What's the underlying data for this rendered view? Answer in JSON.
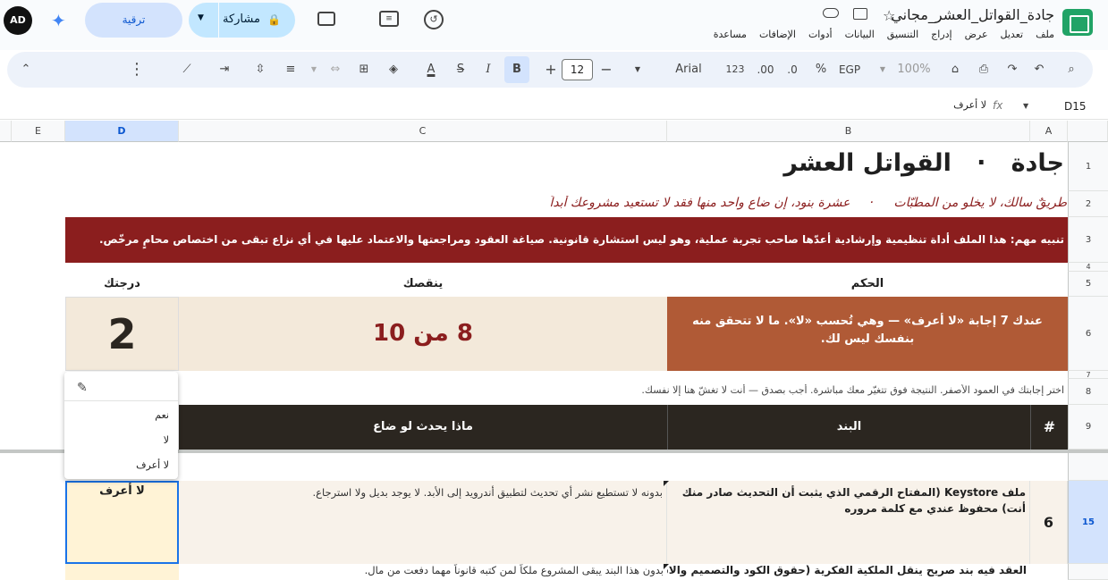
{
  "app": {
    "doc_title": "جادة_القواتل_العشر_مجاني",
    "menu": [
      "ملف",
      "تعديل",
      "عرض",
      "إدراج",
      "التنسيق",
      "البيانات",
      "أدوات",
      "الإضافات",
      "مساعدة"
    ],
    "share_label": "مشاركة",
    "upgrade_label": "ترقية",
    "avatar_initials": "AD"
  },
  "toolbar": {
    "zoom": "100%",
    "currency": "EGP",
    "percent": "%",
    "dec_decrease": ".0",
    "dec_increase": ".00",
    "number_format": "123",
    "font": "Arial",
    "font_size": "12",
    "bold": "B",
    "italic": "I",
    "text_color": "A"
  },
  "formula_bar": {
    "cell_ref": "D15",
    "fx": "fx",
    "value": "لا أعرف"
  },
  "columns": [
    "A",
    "B",
    "C",
    "D",
    "E"
  ],
  "rows": [
    "1",
    "2",
    "3",
    "4",
    "5",
    "6",
    "7",
    "8",
    "9",
    "15"
  ],
  "sheet": {
    "title": "جادة   ·   القواتل العشر",
    "subtitle": "طريقٌ سالك، لا يخلو من المطبّات     ·     عشرة بنود، إن ضاع واحد منها فقد لا تستعيد مشروعك أبداً",
    "warning": "تنبيه مهم:  هذا الملف أداة تنظيمية وإرشادية أعدّها صاحب تجربة عملية،  وهو ليس استشارة قانونية. صياغة العقود ومراجعتها والاعتماد عليها في أي نزاع تبقى من اختصاص محامٍ مرخّص.",
    "header_verdict": "الحكم",
    "header_missing": "ينقصك",
    "header_score": "درجتك",
    "verdict_text": "عندك 7 إجابة «لا أعرف» — وهي تُحسب «لا». ما لا تتحقق منه بنفسك ليس لك.",
    "missing_value": "8 من 10",
    "score_value": "2",
    "instruction": "اختر إجابتك في العمود الأصفر. النتيجة فوق تتغيّر معك مباشرة. أجب بصدق — أنت لا تغشّ هنا إلا نفسك.",
    "table_header": {
      "num": "#",
      "item": "البند",
      "impact": "ماذا يحدث لو ضاع"
    },
    "row15": {
      "num": "6",
      "item": "ملف Keystore (المفتاح الرقمي الذي يثبت أن التحديث صادر منك أنت) محفوظ عندي مع كلمة مروره",
      "impact": "بدونه لا تستطيع نشر أي تحديث لتطبيق أندرويد إلى الأبد. لا يوجد بديل ولا استرجاع.",
      "answer": "لا أعرف"
    },
    "row16": {
      "item": "العقد فيه بند صريح ينقل الملكية الفكرية (حقوق الكود والتصميم والاسم) إليّ",
      "impact": "بدون هذا البند يبقى المشروع ملكاً لمن كتبه قانوناً مهما دفعت من مال."
    }
  },
  "dropdown": {
    "options": [
      "نعم",
      "لا",
      "لا أعرف"
    ]
  },
  "colors": {
    "accent_red": "#8b1e1e",
    "verdict_bg": "#b05a36",
    "score_bg": "#f3e9da",
    "table_header_bg": "#2b2620",
    "answer_bg": "#fff3d6"
  }
}
